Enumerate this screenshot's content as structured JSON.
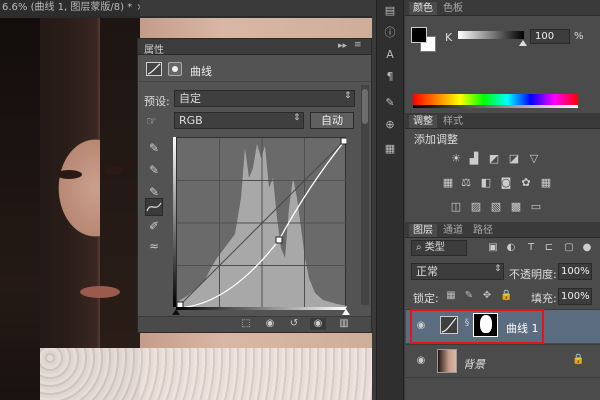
{
  "document": {
    "tab_title": "6.6% (曲线 1, 图层蒙版/8) *",
    "close_glyph": "×"
  },
  "properties": {
    "title": "属性",
    "collapse_glyph": "▸▸",
    "menu_glyph": "≡",
    "type_label": "曲线",
    "preset_label": "预设:",
    "preset_value": "自定",
    "channel_value": "RGB",
    "auto_button": "自动",
    "curve_points": [
      [
        0,
        0
      ],
      [
        0.6,
        0.4
      ],
      [
        1,
        1
      ]
    ]
  },
  "panels": {
    "color_tab": "颜色",
    "swatches_tab": "色板",
    "k_label": "K",
    "k_value": "100",
    "k_unit": "%",
    "k_level": 1.0,
    "adjustments_tab": "调整",
    "styles_tab": "样式",
    "adjustments_title": "添加调整",
    "layers_tab": "图层",
    "channels_tab": "通道",
    "paths_tab": "路径"
  },
  "layers": {
    "filter_label": "类型",
    "blend_mode": "正常",
    "opacity_label": "不透明度:",
    "opacity_value": "100%",
    "lock_label": "锁定:",
    "fill_label": "填充:",
    "fill_value": "100%",
    "items": [
      {
        "name": "曲线 1",
        "selected": true
      },
      {
        "name": "背景",
        "selected": false
      }
    ]
  },
  "colors": {
    "selection_highlight": "#e0161a",
    "selected_layer": "#5c6c80"
  }
}
